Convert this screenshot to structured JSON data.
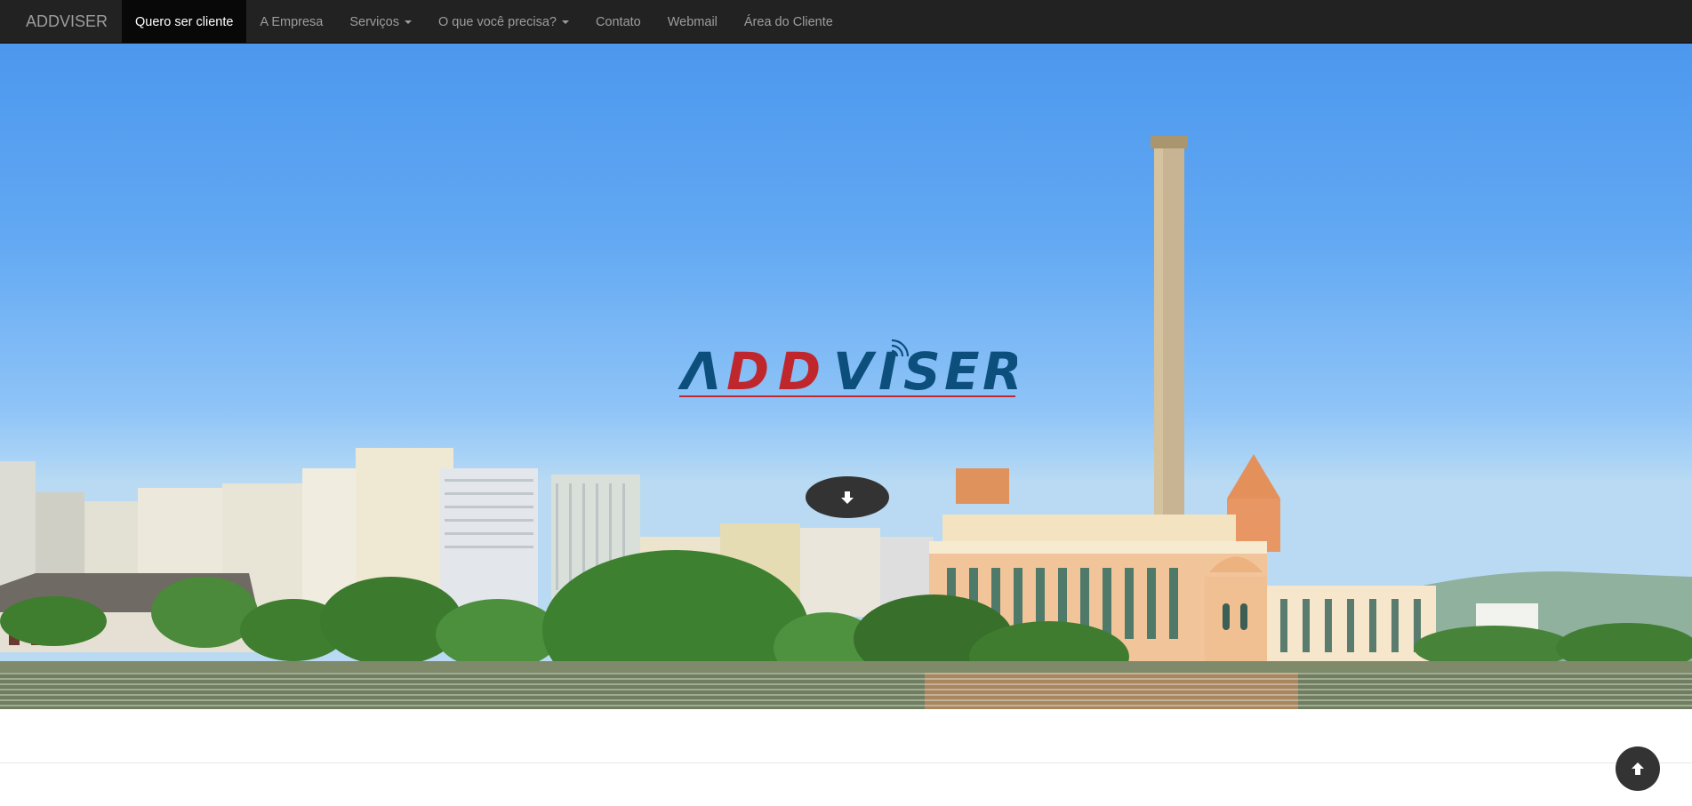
{
  "navbar": {
    "brand": "ADDVISER",
    "items": [
      {
        "label": "Quero ser cliente",
        "active": true
      },
      {
        "label": "A Empresa"
      },
      {
        "label": "Serviços",
        "dropdown": true
      },
      {
        "label": "O que você precisa?",
        "dropdown": true
      },
      {
        "label": "Contato"
      },
      {
        "label": "Webmail"
      },
      {
        "label": "Área do Cliente"
      }
    ]
  },
  "hero": {
    "logo_text": "ADDVISER",
    "scroll_icon": "arrow-down-icon"
  },
  "back_to_top_icon": "arrow-up-icon",
  "colors": {
    "navbar_bg": "#222222",
    "active_bg": "#080808",
    "logo_blue": "#0d4f7c",
    "logo_red": "#c0272d",
    "button_bg": "#333333"
  }
}
